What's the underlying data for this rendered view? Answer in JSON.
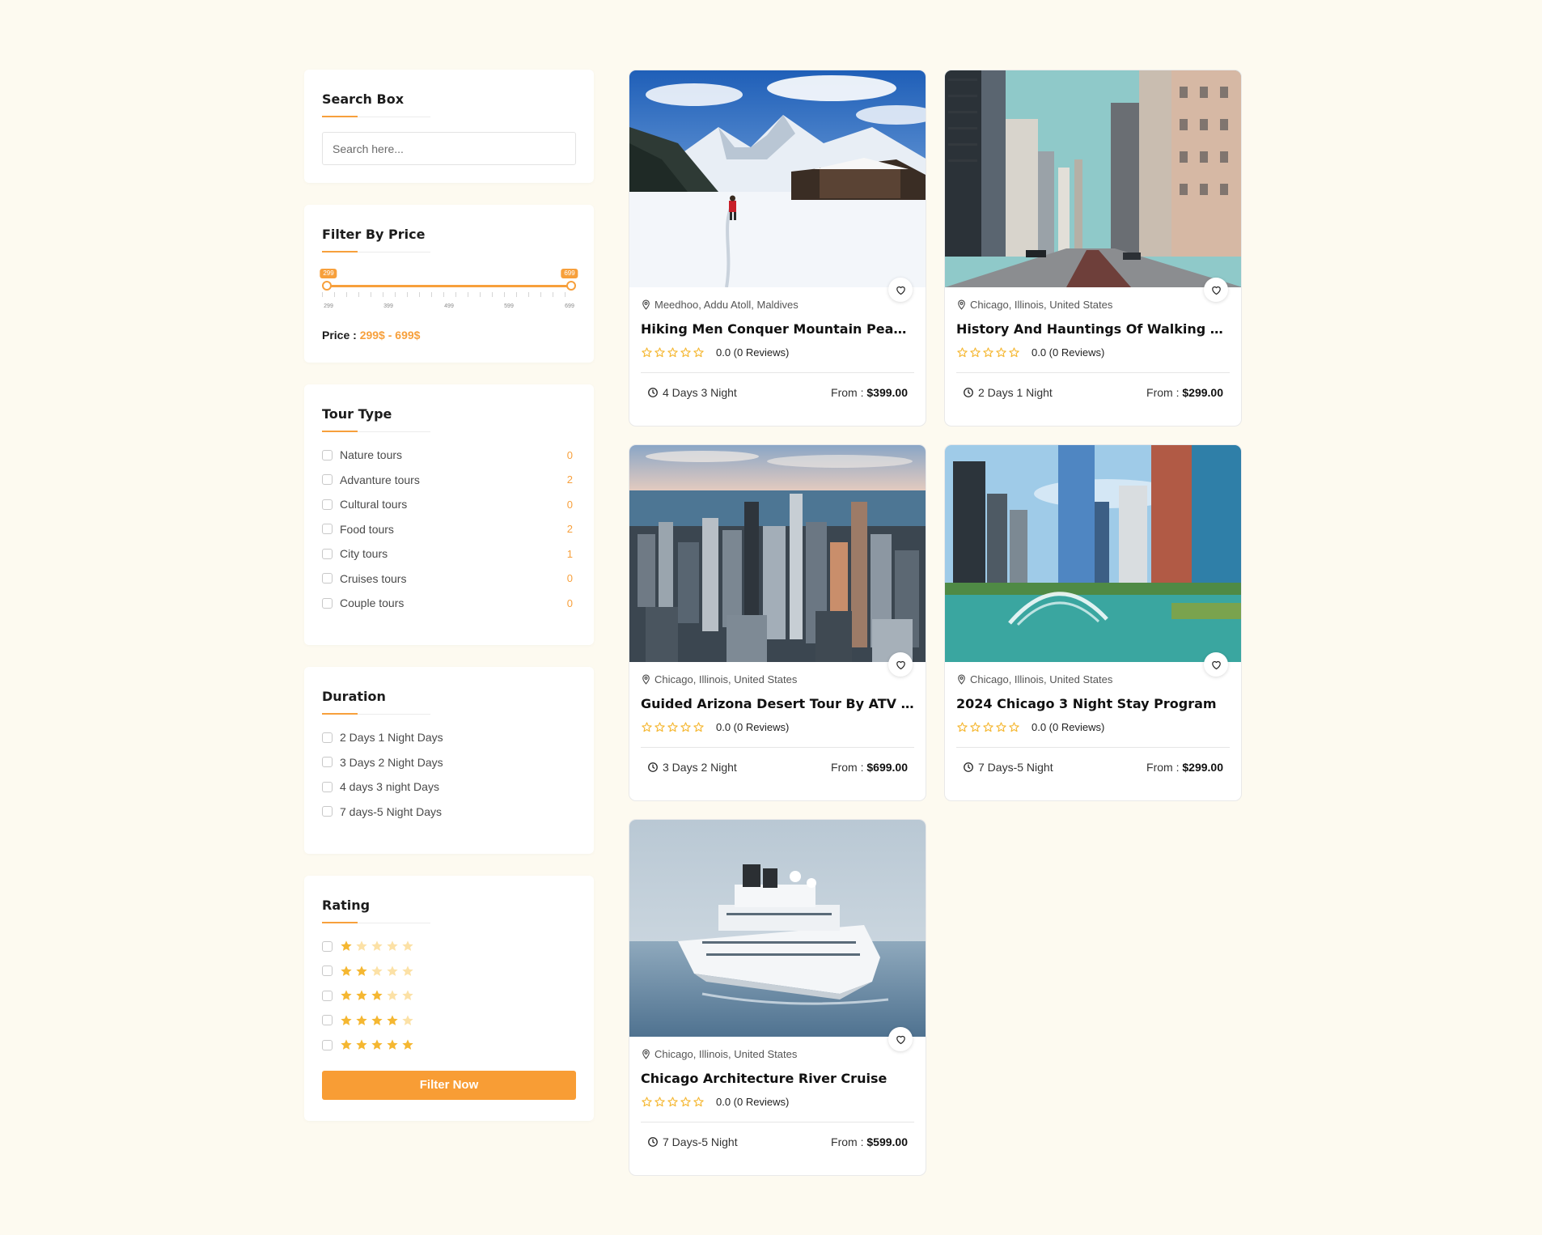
{
  "search": {
    "title": "Search Box",
    "placeholder": "Search here..."
  },
  "price_filter": {
    "title": "Filter By Price",
    "min_bubble": "299",
    "max_bubble": "699",
    "tick_labels": [
      "299",
      "399",
      "499",
      "599",
      "699"
    ],
    "price_label": "Price :",
    "price_value": "299$ - 699$"
  },
  "tour_type": {
    "title": "Tour Type",
    "items": [
      {
        "label": "Nature tours",
        "count": "0"
      },
      {
        "label": "Advanture tours",
        "count": "2"
      },
      {
        "label": "Cultural tours",
        "count": "0"
      },
      {
        "label": "Food tours",
        "count": "2"
      },
      {
        "label": "City tours",
        "count": "1"
      },
      {
        "label": "Cruises tours",
        "count": "0"
      },
      {
        "label": "Couple tours",
        "count": "0"
      }
    ]
  },
  "duration": {
    "title": "Duration",
    "items": [
      {
        "label": "2 Days 1 Night Days"
      },
      {
        "label": "3 Days 2 Night Days"
      },
      {
        "label": "4 days 3 night Days"
      },
      {
        "label": "7 days-5 Night Days"
      }
    ]
  },
  "rating": {
    "title": "Rating",
    "rows": [
      1,
      2,
      3,
      4,
      5
    ],
    "button_label": "Filter Now"
  },
  "colors": {
    "accent": "#f7a03c",
    "button": "#f89d35",
    "star": "#f5b731",
    "star_faded": "#fce1a6",
    "background": "#fdfaf0"
  },
  "tours": [
    {
      "image": "snowy-mountain-hiker",
      "location": "Meedhoo, Addu Atoll, Maldives",
      "title": "Hiking Men Conquer Mountain Peak...",
      "rating_text": "0.0 (0 Reviews)",
      "duration": "4 Days 3 Night",
      "from_label": "From :",
      "price": "$399.00"
    },
    {
      "image": "city-street-skyscrapers",
      "location": "Chicago, Illinois, United States",
      "title": "History And Hauntings Of Walking Tour",
      "rating_text": "0.0 (0 Reviews)",
      "duration": "2 Days 1 Night",
      "from_label": "From :",
      "price": "$299.00"
    },
    {
      "image": "aerial-city-skyline",
      "location": "Chicago, Illinois, United States",
      "title": "Guided Arizona Desert Tour By ATV Tour",
      "rating_text": "0.0 (0 Reviews)",
      "duration": "3 Days 2 Night",
      "from_label": "From :",
      "price": "$699.00"
    },
    {
      "image": "river-fountain-towers",
      "location": "Chicago, Illinois, United States",
      "title": "2024 Chicago 3 Night Stay Program",
      "rating_text": "0.0 (0 Reviews)",
      "duration": "7 Days-5 Night",
      "from_label": "From :",
      "price": "$299.00"
    },
    {
      "image": "cruise-ship",
      "location": "Chicago, Illinois, United States",
      "title": "Chicago Architecture River Cruise",
      "rating_text": "0.0 (0 Reviews)",
      "duration": "7 Days-5 Night",
      "from_label": "From :",
      "price": "$599.00"
    }
  ]
}
